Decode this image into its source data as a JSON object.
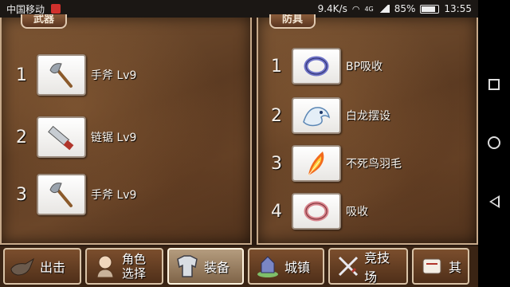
{
  "status_bar": {
    "carrier": "中国移动",
    "speed": "9.4K/s",
    "network": "4G",
    "battery": "85%",
    "time": "13:55"
  },
  "weapons_panel": {
    "header": "武器",
    "slots": [
      {
        "num": "1",
        "label": "手斧 Lv9",
        "icon": "axe-icon"
      },
      {
        "num": "2",
        "label": "链锯 Lv9",
        "icon": "chainsaw-icon"
      },
      {
        "num": "3",
        "label": "手斧 Lv9",
        "icon": "axe-icon"
      }
    ]
  },
  "armor_panel": {
    "header": "防具",
    "slots": [
      {
        "num": "1",
        "label": "BP吸收",
        "icon": "ring-icon"
      },
      {
        "num": "2",
        "label": "白龙摆设",
        "icon": "white-dragon-icon"
      },
      {
        "num": "3",
        "label": "不死鸟羽毛",
        "icon": "phoenix-feather-icon"
      },
      {
        "num": "4",
        "label": "吸收",
        "icon": "ring-icon"
      }
    ]
  },
  "bottom_nav": {
    "sortie": "出击",
    "character_line1": "角色",
    "character_line2": "选择",
    "equipment": "装备",
    "town": "城镇",
    "arena": "竞技场",
    "other": "其"
  },
  "colors": {
    "panel_border": "#c6a98a",
    "active_tab": "#b49c7e"
  }
}
